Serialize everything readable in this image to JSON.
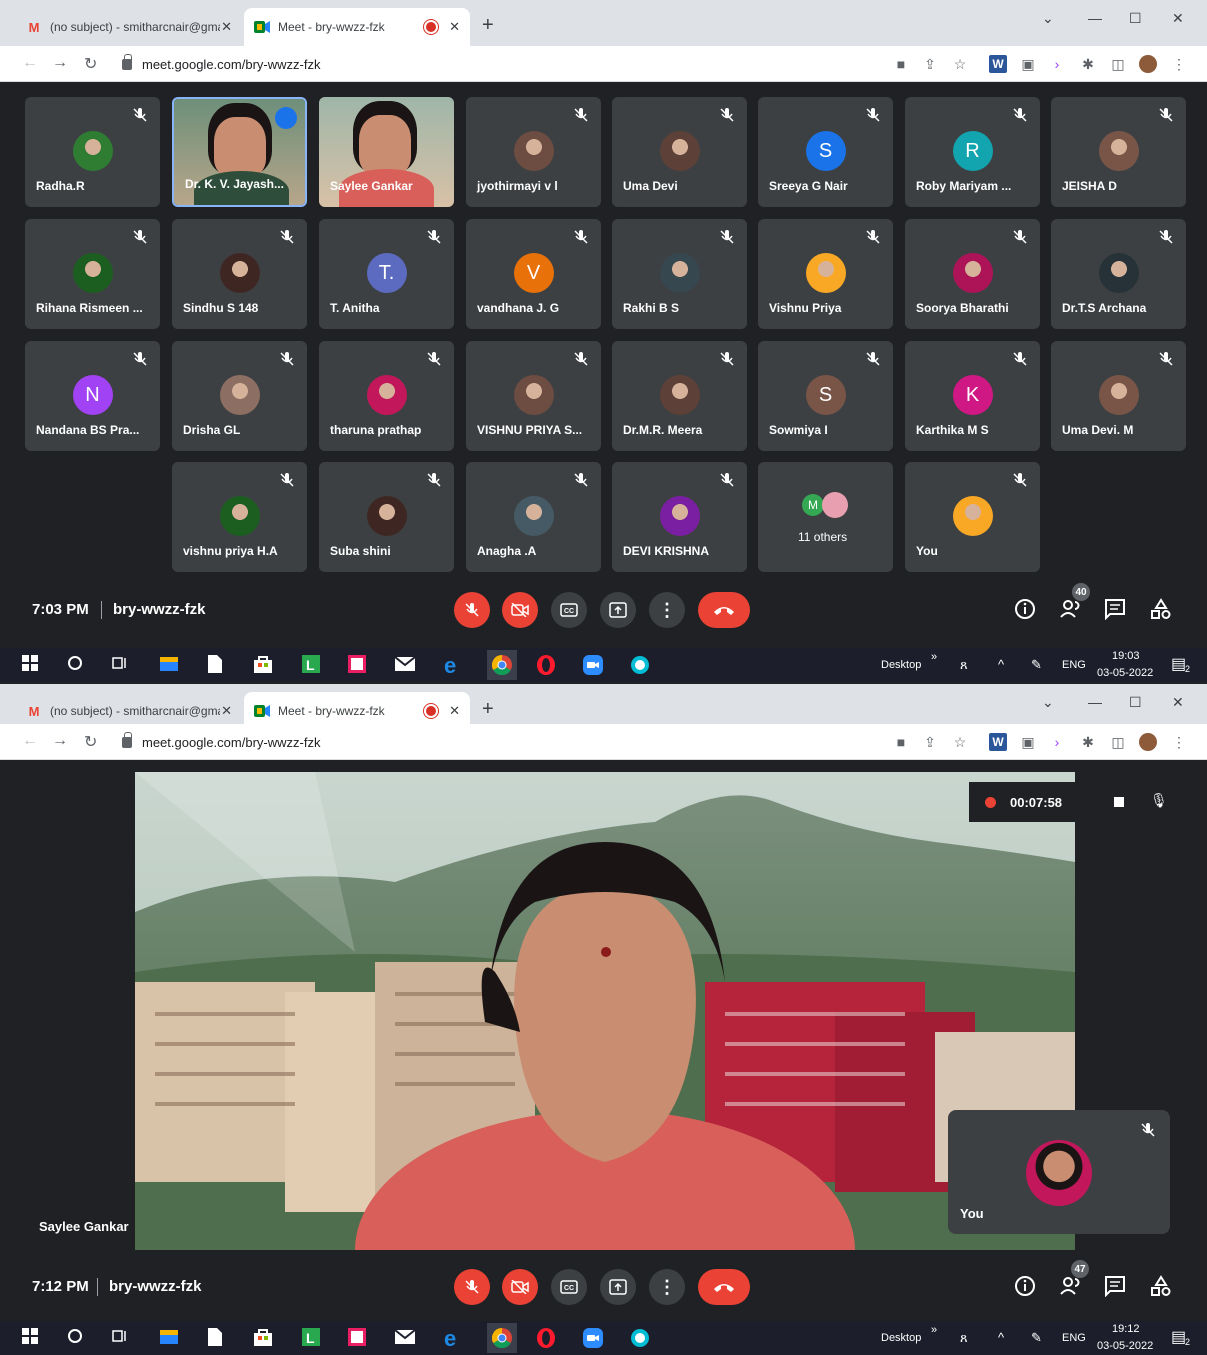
{
  "browser": {
    "tabs": [
      {
        "title": "(no subject) - smitharcnair@gma",
        "icon": "gmail-icon"
      },
      {
        "title": "Meet - bry-wwzz-fzk",
        "icon": "meet-icon",
        "recording": true
      }
    ],
    "url": "meet.google.com/bry-wwzz-fzk"
  },
  "grid_view": {
    "participants": [
      {
        "name": "Radha.R",
        "avatar": "peacock"
      },
      {
        "name": "Dr. K. V. Jayash...",
        "avatar": "video",
        "speaking": true
      },
      {
        "name": "Saylee Gankar",
        "avatar": "video"
      },
      {
        "name": "jyothirmayi v l",
        "avatar": "photo"
      },
      {
        "name": "Uma Devi",
        "avatar": "photo"
      },
      {
        "name": "Sreeya G Nair",
        "letter": "S",
        "color": "#1a73e8"
      },
      {
        "name": "Roby Mariyam ...",
        "letter": "R",
        "color": "#12a4af"
      },
      {
        "name": "JEISHA D",
        "avatar": "photo"
      },
      {
        "name": "Rihana Rismeen ...",
        "avatar": "photo"
      },
      {
        "name": "Sindhu S 148",
        "avatar": "photo"
      },
      {
        "name": "T. Anitha",
        "letter": "T.",
        "color": "#5c6bc0"
      },
      {
        "name": "vandhana J. G",
        "letter": "V",
        "color": "#e8710a"
      },
      {
        "name": "Rakhi B S",
        "avatar": "photo"
      },
      {
        "name": "Vishnu Priya",
        "avatar": "photo"
      },
      {
        "name": "Soorya Bharathi",
        "avatar": "photo"
      },
      {
        "name": "Dr.T.S Archana",
        "avatar": "photo"
      },
      {
        "name": "Nandana BS Pra...",
        "letter": "N",
        "color": "#a142f4"
      },
      {
        "name": "Drisha GL",
        "avatar": "photo"
      },
      {
        "name": "tharuna prathap",
        "avatar": "photo"
      },
      {
        "name": "VISHNU PRIYA S...",
        "avatar": "photo"
      },
      {
        "name": "Dr.M.R. Meera",
        "avatar": "photo"
      },
      {
        "name": "Sowmiya I",
        "letter": "S",
        "color": "#795548"
      },
      {
        "name": "Karthika M S",
        "letter": "K",
        "color": "#d01884"
      },
      {
        "name": "Uma Devi. M",
        "avatar": "photo"
      },
      {
        "name": "vishnu priya H.A",
        "avatar": "photo"
      },
      {
        "name": "Suba shini",
        "avatar": "photo"
      },
      {
        "name": "Anagha .A",
        "avatar": "photo"
      },
      {
        "name": "DEVI KRISHNA",
        "avatar": "photo"
      },
      {
        "name": "11 others",
        "avatar": "group"
      },
      {
        "name": "You",
        "avatar": "photo"
      }
    ],
    "time": "7:03 PM",
    "meeting_code": "bry-wwzz-fzk",
    "people_count": "40"
  },
  "speaker_view": {
    "speaker_name": "Saylee Gankar",
    "self_label": "You",
    "recording_time": "00:07:58",
    "time": "7:12 PM",
    "meeting_code": "bry-wwzz-fzk",
    "people_count": "47"
  },
  "taskbar": {
    "top": {
      "desktop": "Desktop",
      "lang": "ENG",
      "time": "19:03",
      "date": "03-05-2022",
      "notif": "2"
    },
    "bottom": {
      "desktop": "Desktop",
      "lang": "ENG",
      "time": "19:12",
      "date": "03-05-2022",
      "notif": "2"
    }
  }
}
